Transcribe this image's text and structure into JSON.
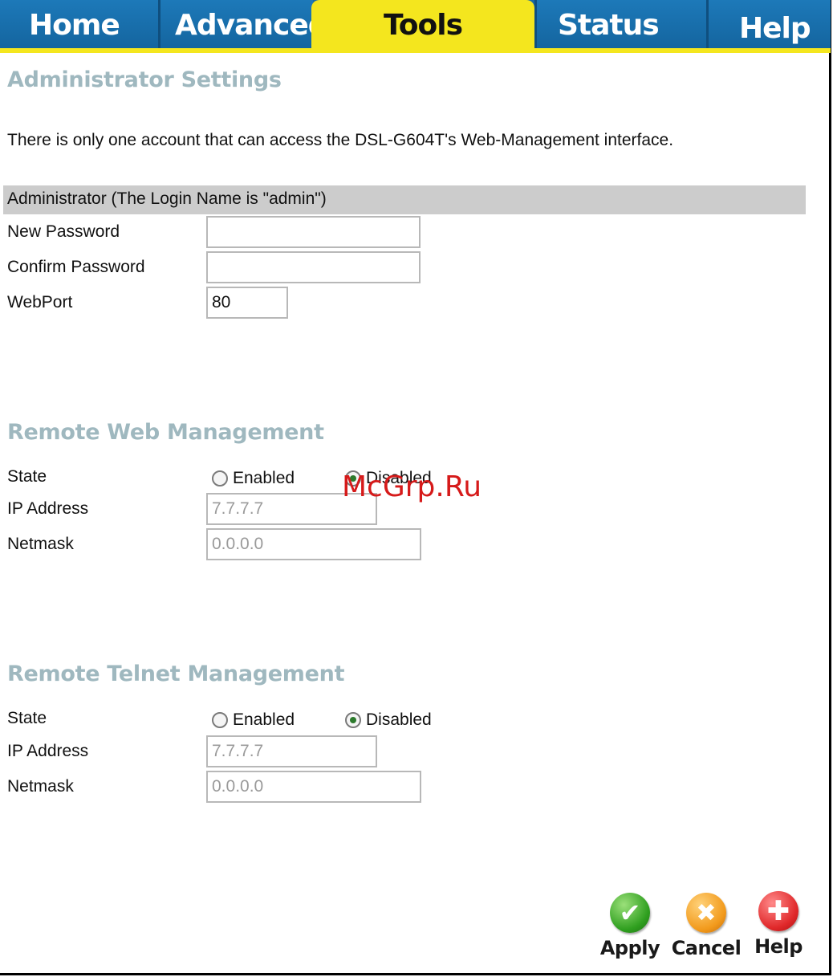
{
  "tabs": [
    {
      "label": "Home",
      "active": false
    },
    {
      "label": "Advanced",
      "active": false
    },
    {
      "label": "Tools",
      "active": true
    },
    {
      "label": "Status",
      "active": false
    },
    {
      "label": "Help",
      "active": false
    }
  ],
  "admin": {
    "title": "Administrator Settings",
    "description": "There is only one account that can access the DSL-G604T's Web-Management interface.",
    "bar_label": "Administrator (The Login Name is \"admin\")",
    "new_password_label": "New Password",
    "new_password_value": "",
    "confirm_password_label": "Confirm Password",
    "confirm_password_value": "",
    "webport_label": "WebPort",
    "webport_value": "80"
  },
  "remote_web": {
    "title": "Remote Web Management",
    "state_label": "State",
    "enabled_label": "Enabled",
    "disabled_label": "Disabled",
    "selected": "Disabled",
    "ip_label": "IP Address",
    "ip_value": "7.7.7.7",
    "netmask_label": "Netmask",
    "netmask_value": "0.0.0.0"
  },
  "remote_telnet": {
    "title": "Remote Telnet Management",
    "state_label": "State",
    "enabled_label": "Enabled",
    "disabled_label": "Disabled",
    "selected": "Disabled",
    "ip_label": "IP Address",
    "ip_value": "7.7.7.7",
    "netmask_label": "Netmask",
    "netmask_value": "0.0.0.0"
  },
  "actions": {
    "apply": "Apply",
    "cancel": "Cancel",
    "help": "Help"
  },
  "watermark": "McGrp.Ru",
  "colors": {
    "tab_blue": "#1a6aa4",
    "tab_active": "#f4e61e",
    "section_title": "#9fb8bf"
  }
}
